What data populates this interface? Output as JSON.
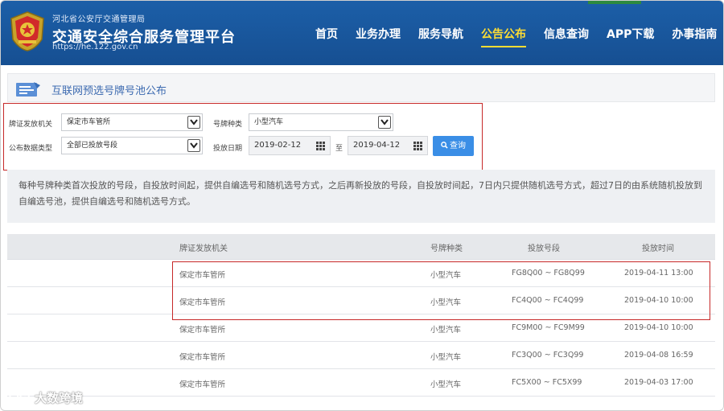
{
  "header": {
    "subtitle": "河北省公安厅交通管理局",
    "title": "交通安全综合服务管理平台",
    "url": "https://he.122.gov.cn",
    "nav": [
      {
        "label": "首页",
        "active": false
      },
      {
        "label": "业务办理",
        "active": false
      },
      {
        "label": "服务导航",
        "active": false
      },
      {
        "label": "公告公布",
        "active": true
      },
      {
        "label": "信息查询",
        "active": false
      },
      {
        "label": "APP下载",
        "active": false
      },
      {
        "label": "办事指南",
        "active": false
      }
    ]
  },
  "section": {
    "title": "互联网预选号牌号池公布",
    "icon": "document-list-icon"
  },
  "filters": {
    "issuer_label": "牌证发放机关",
    "issuer_value": "保定市车管所",
    "plate_type_label": "号牌种类",
    "plate_type_value": "小型汽车",
    "data_type_label": "公布数据类型",
    "data_type_value": "全部已投放号段",
    "date_label": "投放日期",
    "date_from": "2019-02-12",
    "date_sep": "至",
    "date_to": "2019-04-12",
    "query_label": "查询"
  },
  "notice": "每种号牌种类首次投放的号段，自投放时间起，提供自编选号和随机选号方式，之后再新投放的号段，自投放时间起，7日内只提供随机选号方式，超过7日的由系统随机投放到自编选号池，提供自编选号和随机选号方式。",
  "table": {
    "headers": [
      "牌证发放机关",
      "号牌种类",
      "投放号段",
      "投放时间"
    ],
    "rows": [
      [
        "保定市车管所",
        "小型汽车",
        "FG8Q00 ~ FG8Q99",
        "2019-04-11 13:00"
      ],
      [
        "保定市车管所",
        "小型汽车",
        "FC4Q00 ~ FC4Q99",
        "2019-04-10 10:00"
      ],
      [
        "保定市车管所",
        "小型汽车",
        "FC9M00 ~ FC9M99",
        "2019-04-10 10:00"
      ],
      [
        "保定市车管所",
        "小型汽车",
        "FC3Q00 ~ FC3Q99",
        "2019-04-08 16:59"
      ],
      [
        "保定市车管所",
        "小型汽车",
        "FC5X00 ~ FC5X99",
        "2019-04-03 17:00"
      ]
    ]
  },
  "watermark": "大数跨境",
  "colors": {
    "header_blue": "#1c5fa8",
    "nav_active": "#ffdd33",
    "highlight_red": "#c62828",
    "button_blue": "#3a8ee6"
  }
}
